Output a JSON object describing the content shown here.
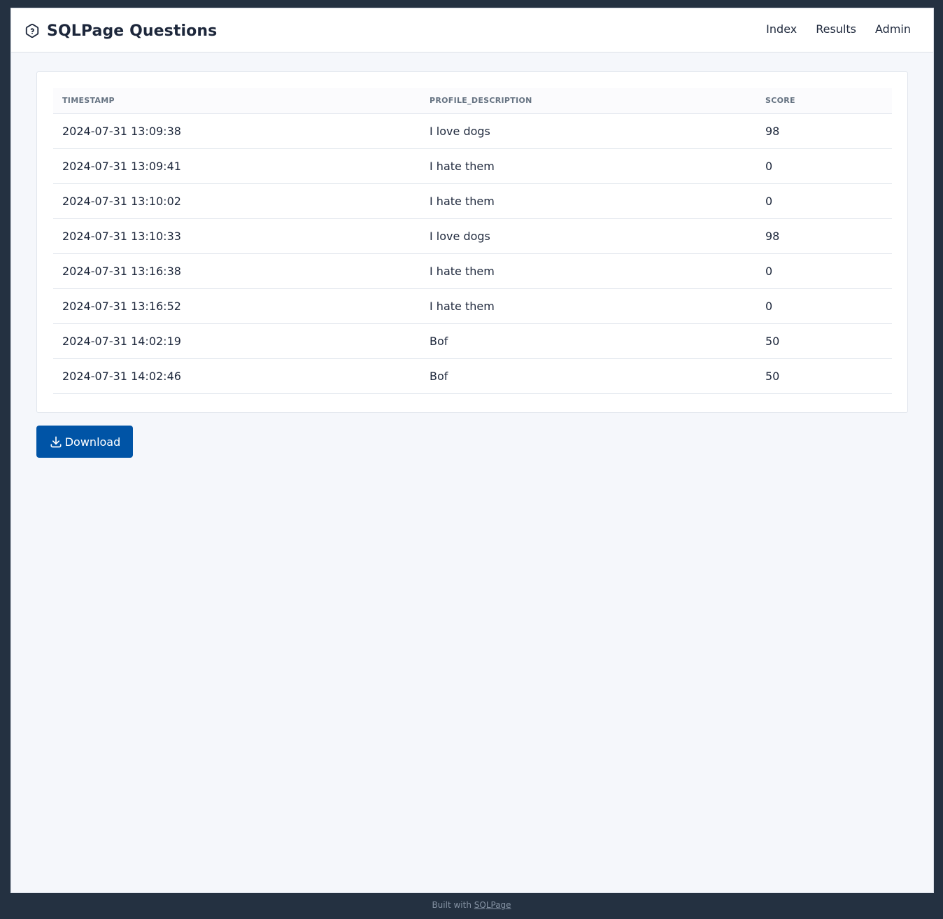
{
  "header": {
    "title": "SQLPage Questions",
    "brand_icon": "hexagon-question-icon",
    "nav": [
      {
        "label": "Index"
      },
      {
        "label": "Results"
      },
      {
        "label": "Admin"
      }
    ]
  },
  "table": {
    "columns": [
      "TIMESTAMP",
      "PROFILE_DESCRIPTION",
      "SCORE"
    ],
    "rows": [
      [
        "2024-07-31 13:09:38",
        "I love dogs",
        "98"
      ],
      [
        "2024-07-31 13:09:41",
        "I hate them",
        "0"
      ],
      [
        "2024-07-31 13:10:02",
        "I hate them",
        "0"
      ],
      [
        "2024-07-31 13:10:33",
        "I love dogs",
        "98"
      ],
      [
        "2024-07-31 13:16:38",
        "I hate them",
        "0"
      ],
      [
        "2024-07-31 13:16:52",
        "I hate them",
        "0"
      ],
      [
        "2024-07-31 14:02:19",
        "Bof",
        "50"
      ],
      [
        "2024-07-31 14:02:46",
        "Bof",
        "50"
      ]
    ]
  },
  "download": {
    "label": "Download",
    "icon": "download-icon",
    "color": "#0054a6"
  },
  "footer": {
    "prefix": "Built with",
    "link_label": "SQLPage"
  },
  "colors": {
    "page_background": "#243141",
    "content_background": "#f5f7fb",
    "text": "#1d273b",
    "muted": "#667382"
  }
}
